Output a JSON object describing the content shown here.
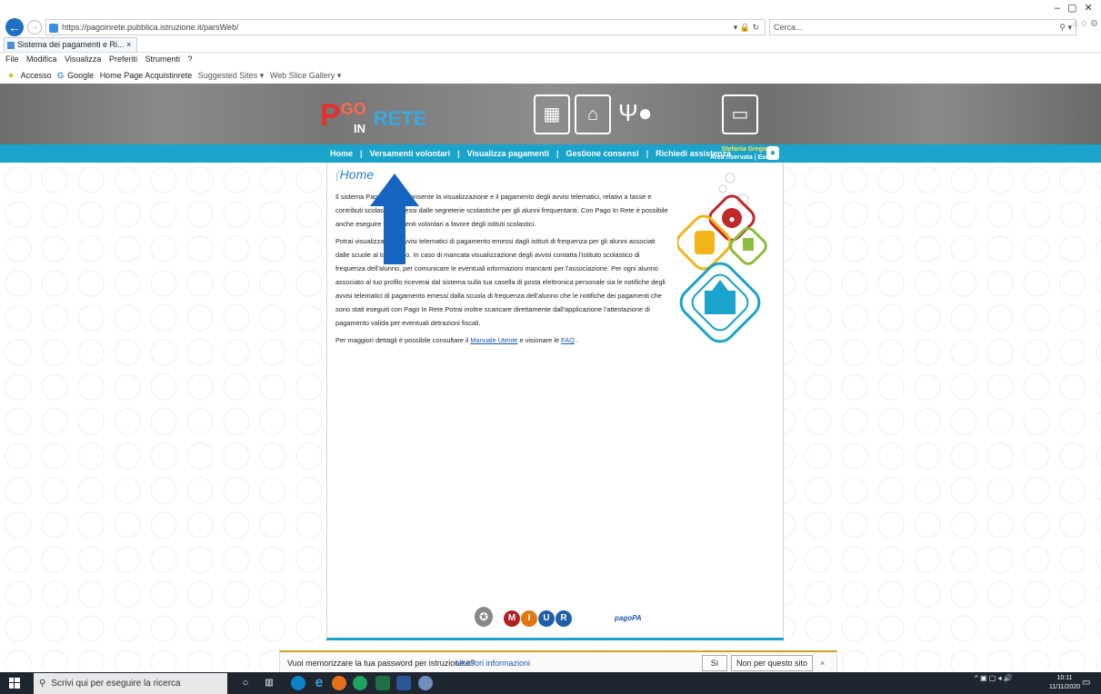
{
  "browser": {
    "url": "https://pagoinrete.pubblica.istruzione.it/parsWeb/",
    "search_placeholder": "Cerca...",
    "tab_title": "Sistema dei pagamenti e Ri...",
    "menu": [
      "File",
      "Modifica",
      "Visualizza",
      "Preferiti",
      "Strumenti",
      "?"
    ],
    "favorites": [
      "Accesso",
      "Google",
      "Home Page Acquistinrete",
      "Suggested Sites ▾",
      "Web Slice Gallery ▾"
    ]
  },
  "site": {
    "logo": {
      "p": "P",
      "go": "GO",
      "in": "IN",
      "rete": "RETE"
    },
    "nav": [
      {
        "label": "Home"
      },
      {
        "label": "Versamenti volontari"
      },
      {
        "label": "Visualizza pagamenti"
      },
      {
        "label": "Gestione consensi"
      },
      {
        "label": "Richiedi assistenza"
      }
    ],
    "user": {
      "name": "Stefania Gregori",
      "area": "Area riservata | Esci"
    }
  },
  "content": {
    "title": "Home",
    "paragraph1": "Il sistema Pago In Rete consente la visualizzazione e il pagamento degli avvisi telematici, relativi a tasse e contributi scolastici, emessi dalle segreterie scolastiche per gli alunni frequentanti. Con Pago In Rete è possibile anche eseguire versamenti volontari a favore degli istituti scolastici.",
    "paragraph2": "Potrai visualizzare gli avvisi telematici di pagamento emessi dagli istituti di frequenza per gli alunni associati dalle scuole al tuo profilo. In caso di mancata visualizzazione degli avvisi contatta l'istituto scolastico di frequenza dell'alunno, per comunicare le eventuali informazioni mancanti per l'associazione. Per ogni alunno associato al tuo profilo riceverai dal sistema sulla tua casella di posta elettronica personale sia le notifiche degli avvisi telematici di pagamento emessi dalla scuola di frequenza dell'alunno che le notifiche dei pagamenti che sono stati eseguiti con Pago In Rete.Potrai inoltre scaricare direttamente dall'applicazione l'attestazione di pagamento valida per eventuali detrazioni fiscali.",
    "p3_before": "Per maggiori dettagli è possibile consultare il ",
    "manual_link": "Manuale Utente",
    "p3_middle": " e visionare le ",
    "faq_link": "FAQ",
    "p3_after": " ."
  },
  "footer": {
    "miur_letters": [
      "M",
      "I",
      "U",
      "R"
    ],
    "pagopa": "pagoPA"
  },
  "password_bar": {
    "question": "Vuoi memorizzare la tua password per istruzione.it?",
    "more": "Ulteriori informazioni",
    "yes": "Sì",
    "no": "Non per questo sito",
    "close": "×"
  },
  "taskbar": {
    "search_placeholder": "Scrivi qui per eseguire la ricerca",
    "time": "10:11",
    "date": "11/11/2020"
  },
  "colors": {
    "nav": "#1aa3cb",
    "arrow": "#1565c0",
    "link": "#1a57b8",
    "title": "#2e80c4"
  }
}
